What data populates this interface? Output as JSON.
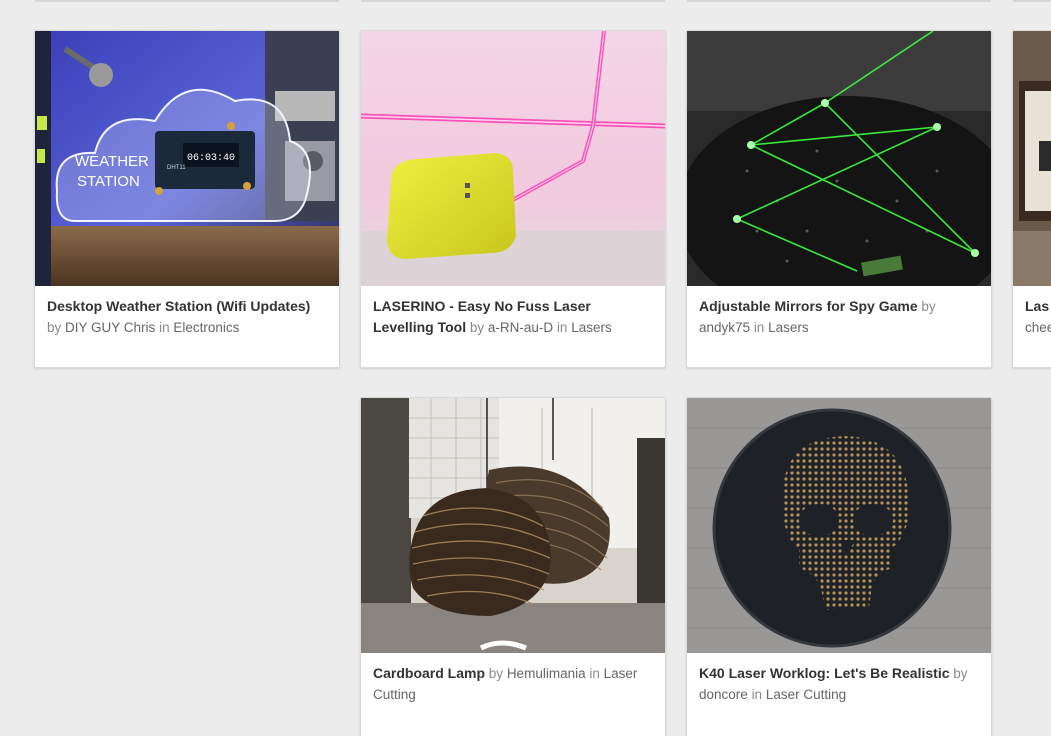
{
  "colors": {
    "page_background": "#ececec",
    "card_background": "#ffffff",
    "title_text": "#333333",
    "meta_text": "#888888"
  },
  "meta_words": {
    "by": "by",
    "in": "in"
  },
  "cards": [
    {
      "title": "Desktop Weather Station (Wifi Updates)",
      "author": "DIY GUY Chris",
      "category": "Electronics",
      "image_text": {
        "label_line1": "WEATHER",
        "label_line2": "STATION",
        "clock": "06:03:40",
        "sensor": "DHT11"
      }
    },
    {
      "title": "LASERINO - Easy No Fuss Laser Levelling Tool",
      "author": "a-RN-au-D",
      "category": "Lasers"
    },
    {
      "title": "Adjustable Mirrors for Spy Game",
      "author": "andyk75",
      "category": "Lasers"
    },
    {
      "title": "Las",
      "author": "chee"
    },
    {
      "title": "Cardboard Lamp",
      "author": "Hemulimania",
      "category": "Laser Cutting"
    },
    {
      "title": "K40 Laser Worklog: Let's Be Realistic",
      "author": "doncore",
      "category": "Laser Cutting"
    }
  ]
}
